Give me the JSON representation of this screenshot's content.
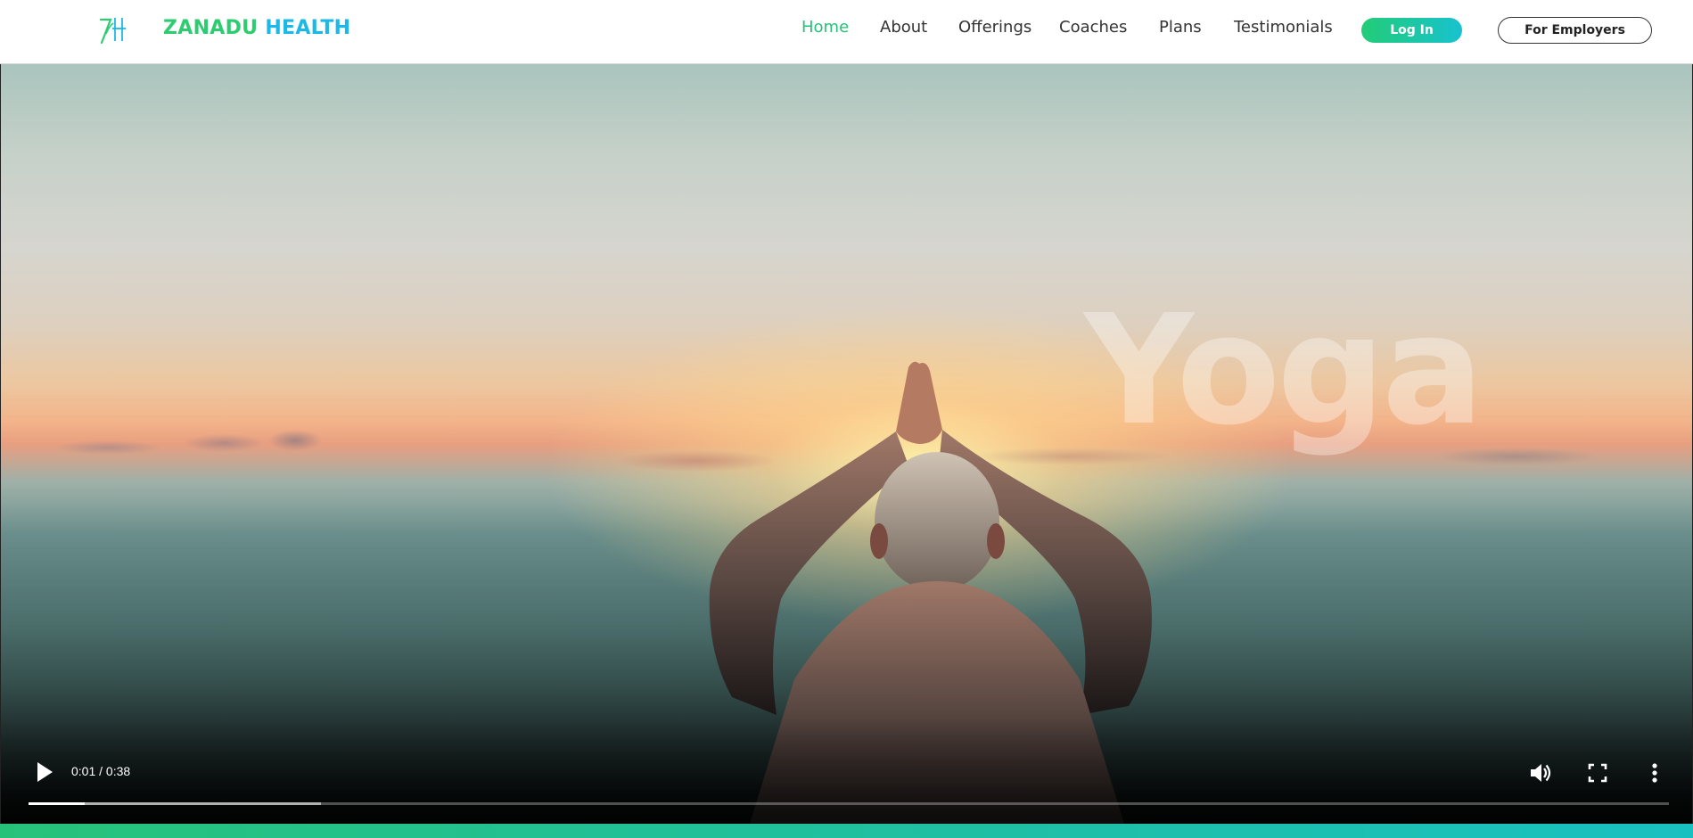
{
  "header": {
    "brand_word1": "ZANADU",
    "brand_word2": "HEALTH",
    "logo_icon": "zh-monogram-icon",
    "nav": [
      {
        "label": "Home",
        "active": true
      },
      {
        "label": "About",
        "active": false
      },
      {
        "label": "Offerings",
        "active": false
      },
      {
        "label": "Coaches",
        "active": false
      },
      {
        "label": "Plans",
        "active": false
      },
      {
        "label": "Testimonials",
        "active": false
      }
    ],
    "login_label": "Log In",
    "employers_label": "For Employers"
  },
  "video": {
    "overlay_text": "Yoga",
    "time_display": "0:01 / 0:38",
    "played_fraction": 0.034,
    "buffered_fraction": 0.178,
    "icons": [
      "play-icon",
      "volume-icon",
      "fullscreen-icon",
      "more-options-icon"
    ]
  },
  "colors": {
    "brand_green": "#2ecc71",
    "brand_blue": "#1cb8e8",
    "nav_active": "#27c27a",
    "login_gradient_start": "#22cc77",
    "login_gradient_end": "#18c2cf"
  }
}
